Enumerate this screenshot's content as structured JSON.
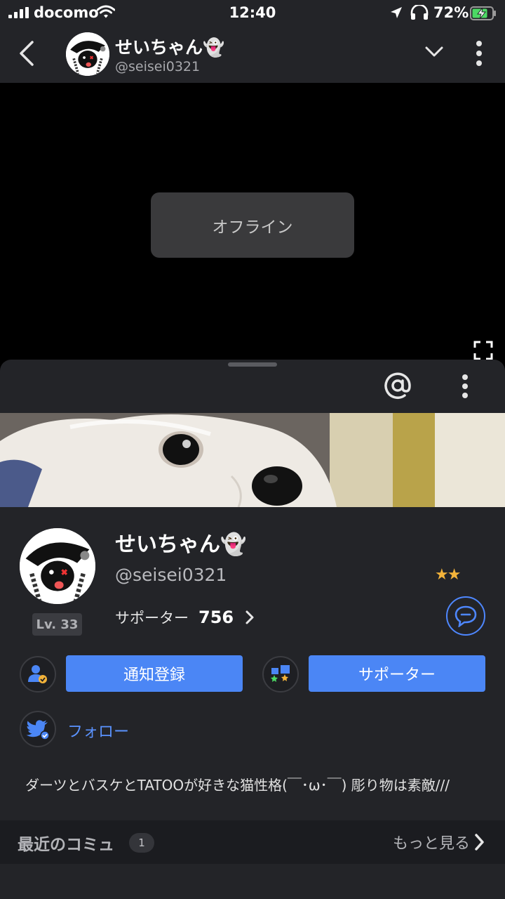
{
  "status_bar": {
    "carrier": "docomo",
    "time": "12:40",
    "battery_percent": "72%",
    "icons": [
      "signal-icon",
      "wifi-icon",
      "location-icon",
      "headphones-icon",
      "battery-charging-icon"
    ]
  },
  "header": {
    "name": "せいちゃん👻",
    "handle": "@seisei0321",
    "icons": [
      "back-icon",
      "chevron-down-icon",
      "more-vertical-icon"
    ]
  },
  "player": {
    "status": "オフライン",
    "icons": [
      "fullscreen-icon"
    ]
  },
  "profile": {
    "name": "せいちゃん👻",
    "handle": "@seisei0321",
    "level": "Lv. 33",
    "stars": "★★",
    "supporter_label": "サポーター",
    "supporter_count": "756",
    "notify_button": "通知登録",
    "supporter_button": "サポーター",
    "follow_label": "フォロー",
    "bio": "ダーツとバスケとTATOOが好きな猫性格(￣･ω･￣) 彫り物は素敵///",
    "icons": [
      "at-icon",
      "more-vertical-icon",
      "message-icon",
      "user-check-icon",
      "supporter-badge-icon",
      "twitter-icon"
    ]
  },
  "recent": {
    "title": "最近のコミュ",
    "count": "1",
    "more": "もっと見る"
  },
  "colors": {
    "accent": "#4b86f5",
    "link": "#5b93ff",
    "background": "#232428",
    "star": "#f3b33a"
  }
}
